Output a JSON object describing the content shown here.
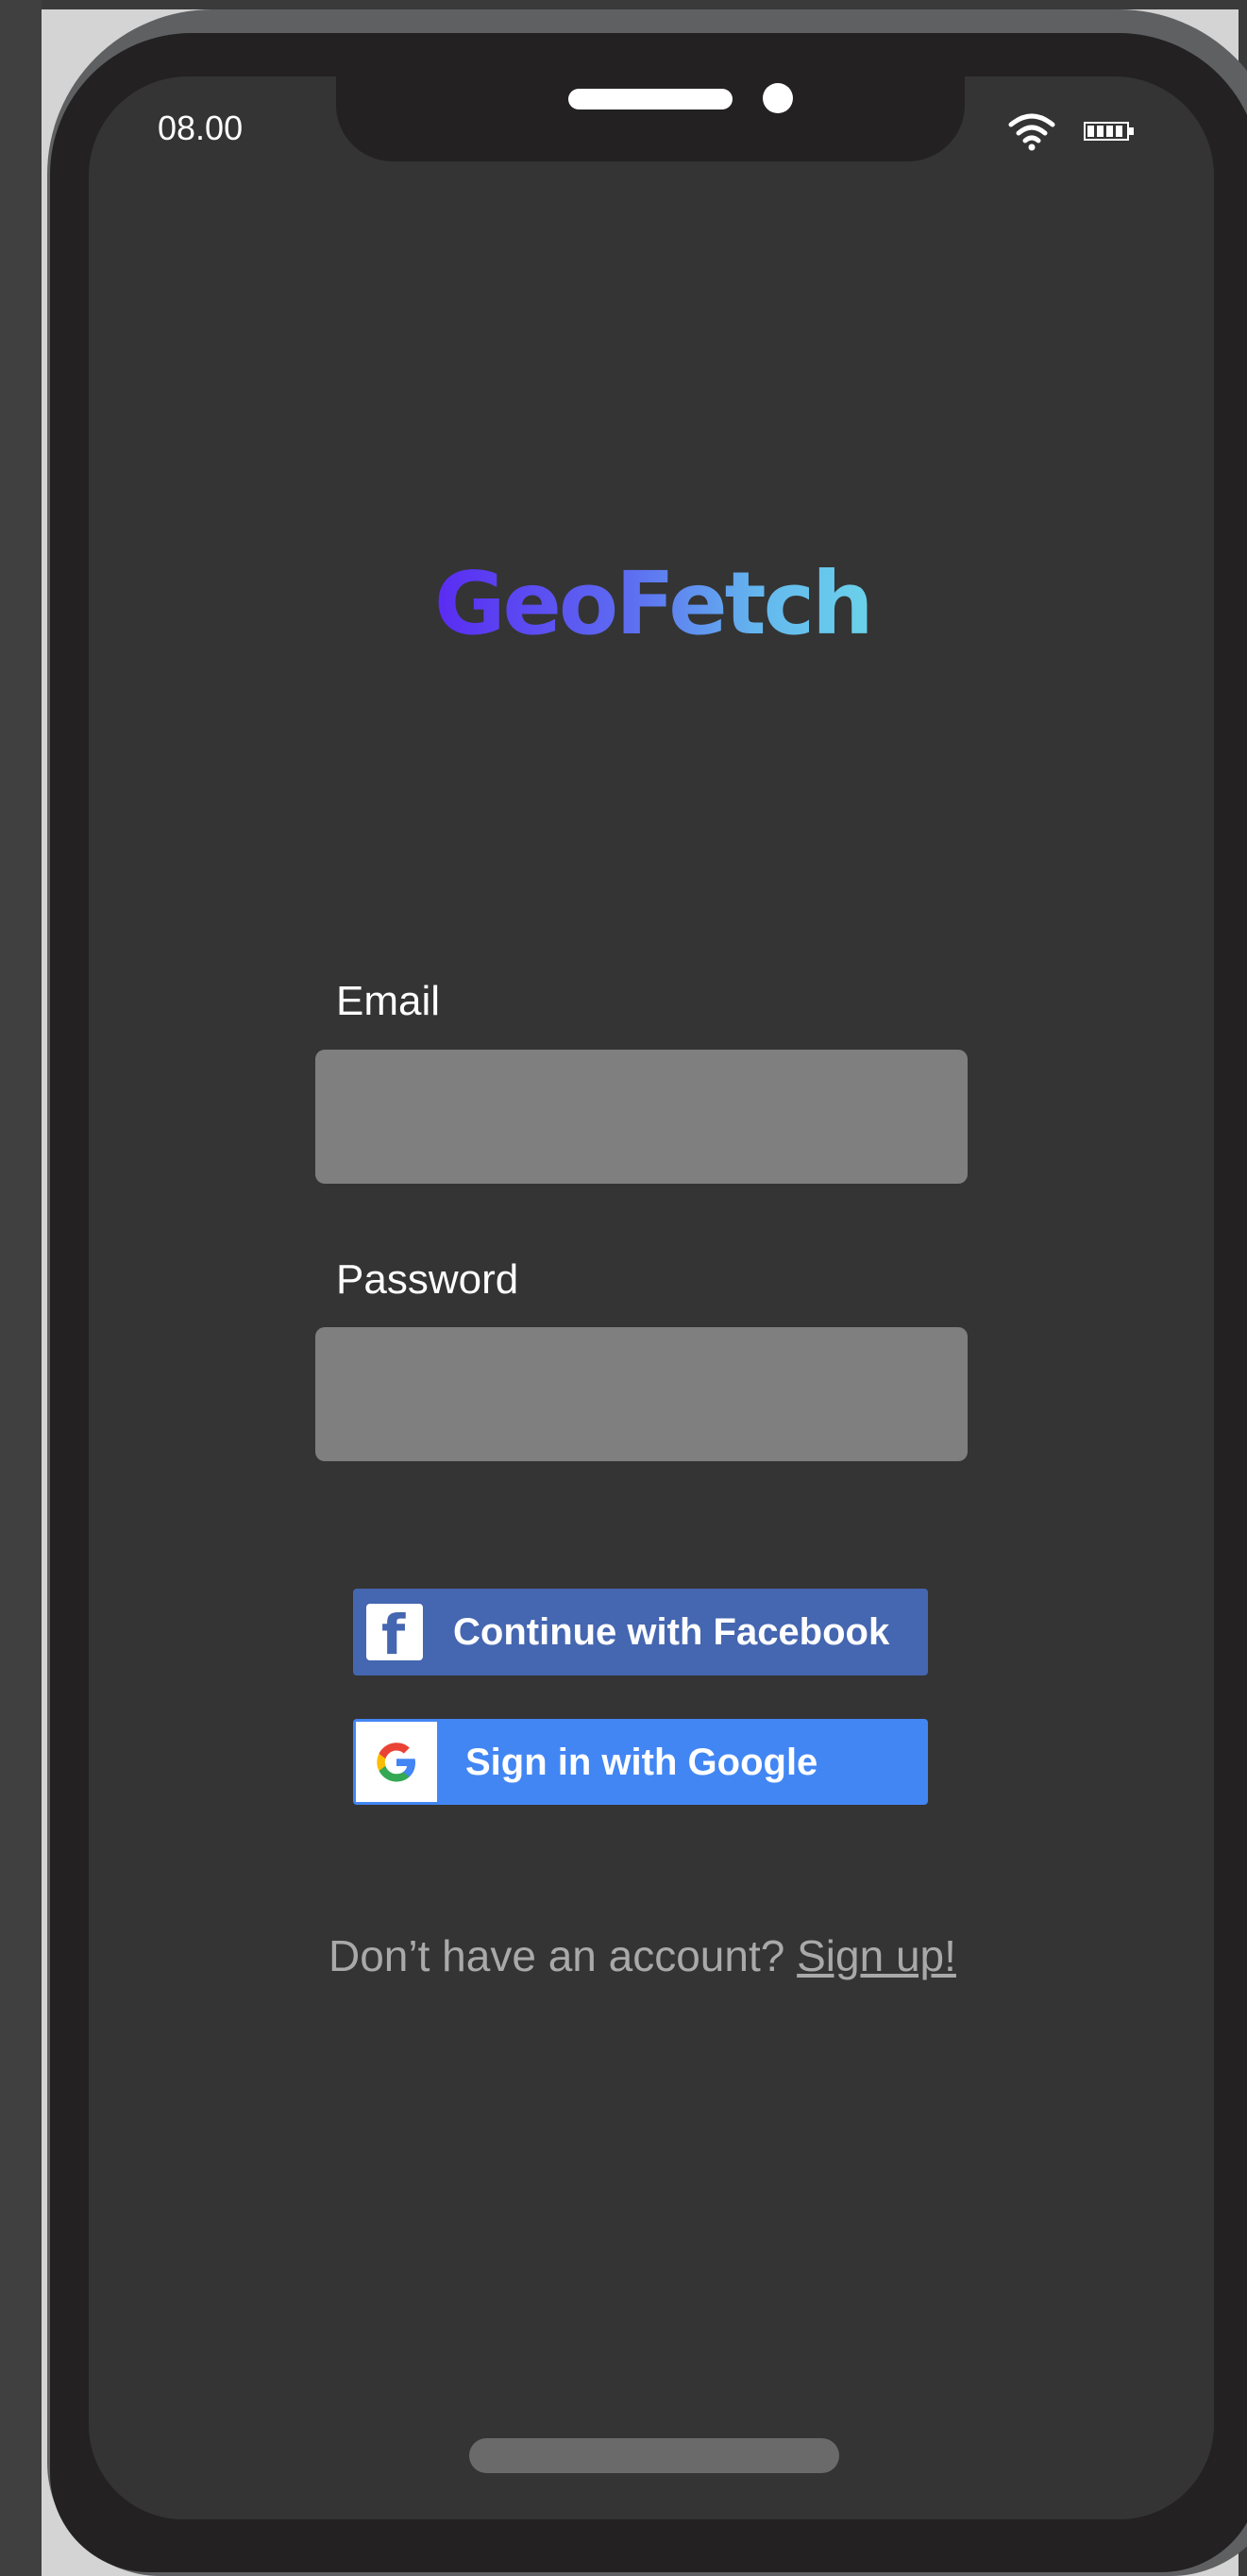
{
  "status_bar": {
    "time": "08.00"
  },
  "app": {
    "logo": "GeoFetch"
  },
  "form": {
    "email_label": "Email",
    "email_value": "",
    "password_label": "Password",
    "password_value": ""
  },
  "social": {
    "facebook_label": "Continue with Facebook",
    "google_label": "Sign in with Google"
  },
  "signup": {
    "prompt": "Don’t have an account? ",
    "link": "Sign up!"
  },
  "colors": {
    "screen_bg": "#343434",
    "bezel": "#232122",
    "input_bg": "#7f7f7f",
    "facebook_blue": "#4566b0",
    "google_blue": "#4286f4",
    "logo_gradient_start": "#5a2bf2",
    "logo_gradient_end": "#6bd2ea"
  },
  "icons": {
    "wifi": "wifi-icon",
    "battery": "battery-icon",
    "facebook": "facebook-logo-icon",
    "google": "google-logo-icon"
  }
}
